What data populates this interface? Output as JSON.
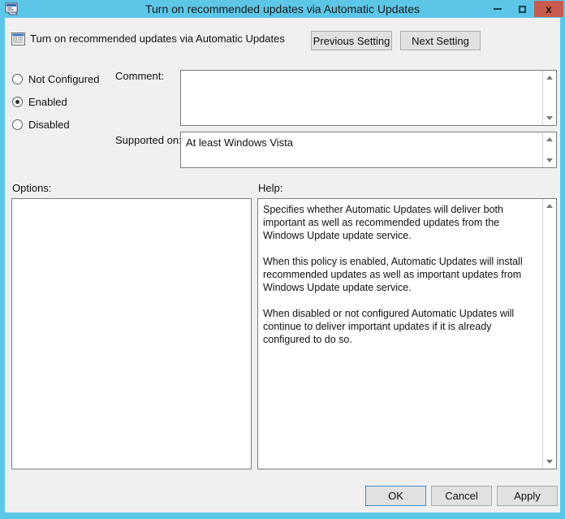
{
  "window": {
    "title": "Turn on recommended updates via Automatic Updates",
    "app_icon": "policy-window-icon",
    "accent_color": "#5cc6e8",
    "close_color": "#c75b4e",
    "client_bg": "#f0f0f0"
  },
  "caption": {
    "minimize": "minimize-icon",
    "maximize": "maximize-icon",
    "close": "x"
  },
  "header": {
    "icon": "policy-setting-icon",
    "policy_name": "Turn on recommended updates via Automatic Updates",
    "previous_label": "Previous Setting",
    "next_label": "Next Setting"
  },
  "state": {
    "options": [
      {
        "id": "not-configured",
        "label": "Not Configured",
        "selected": false
      },
      {
        "id": "enabled",
        "label": "Enabled",
        "selected": true
      },
      {
        "id": "disabled",
        "label": "Disabled",
        "selected": false
      }
    ]
  },
  "comment": {
    "label": "Comment:",
    "value": "",
    "placeholder": ""
  },
  "supported_on": {
    "label": "Supported on:",
    "value": "At least Windows Vista"
  },
  "options_panel": {
    "label": "Options:",
    "content": ""
  },
  "help_panel": {
    "label": "Help:",
    "paragraphs": [
      "Specifies whether Automatic Updates will deliver both important as well as recommended updates from the Windows Update update service.",
      "When this policy is enabled, Automatic Updates will install recommended updates as well as important updates from Windows Update update service.",
      "When disabled or not configured Automatic Updates will continue to deliver important updates if it is already configured to do so."
    ]
  },
  "footer": {
    "ok_label": "OK",
    "cancel_label": "Cancel",
    "apply_label": "Apply",
    "default_button": "OK"
  }
}
